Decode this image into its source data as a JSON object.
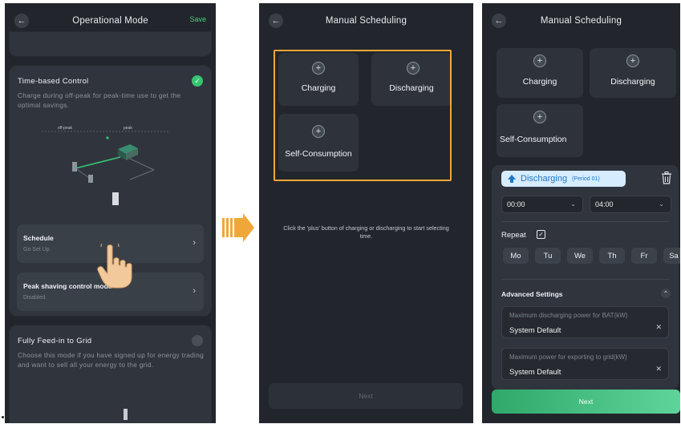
{
  "screen1": {
    "title": "Operational Mode",
    "save": "Save",
    "time_control": {
      "title": "Time-based Control",
      "description": "Charge during off-peak for peak-time use to get the optimal savings.",
      "diagram_labels": {
        "offpeak": "off-peak",
        "peak": "peak"
      }
    },
    "schedule": {
      "title": "Schedule",
      "sub": "Go Set Up"
    },
    "peak_shaving": {
      "title": "Peak shaving control mode",
      "sub": "Disabled"
    },
    "feed_in": {
      "title": "Fully Feed-in to Grid",
      "description": "Choose this mode if you have signed up for energy trading and want to sell all your energy to the grid."
    }
  },
  "screen2": {
    "title": "Manual Scheduling",
    "tiles": [
      "Charging",
      "Discharging",
      "Self-Consumption"
    ],
    "hint": "Click the 'plus' button of charging or discharging to start selecting time.",
    "next": "Next"
  },
  "screen3": {
    "title": "Manual Scheduling",
    "tiles": [
      "Charging",
      "Discharging",
      "Self-Consumption"
    ],
    "period": {
      "mode": "Discharging",
      "period_label": "(Period 01)",
      "start": "00:00",
      "end": "04:00",
      "repeat_label": "Repeat",
      "days": [
        "Mo",
        "Tu",
        "We",
        "Th",
        "Fr",
        "Sa"
      ]
    },
    "advanced": {
      "title": "Advanced Settings",
      "fields": [
        {
          "label": "Maximum discharging power for BAT(kW)",
          "value": "System Default"
        },
        {
          "label": "Maximum power for exporting to grid(kW)",
          "value": "System Default"
        }
      ]
    },
    "next": "Next"
  },
  "icons": {
    "back": "arrow-left-icon",
    "check": "check-circle-icon",
    "plus": "plus-circle-icon",
    "trash": "trash-icon",
    "chevron": "chevron-right-icon",
    "pointer": "hand-pointer-icon",
    "flow_arrow": "arrow-right-icon"
  },
  "colors": {
    "background": "#22262c",
    "card": "#30353d",
    "accent_green": "#37c371",
    "highlight_orange": "#f0a73a",
    "pill_blue": "#1d78c6"
  }
}
